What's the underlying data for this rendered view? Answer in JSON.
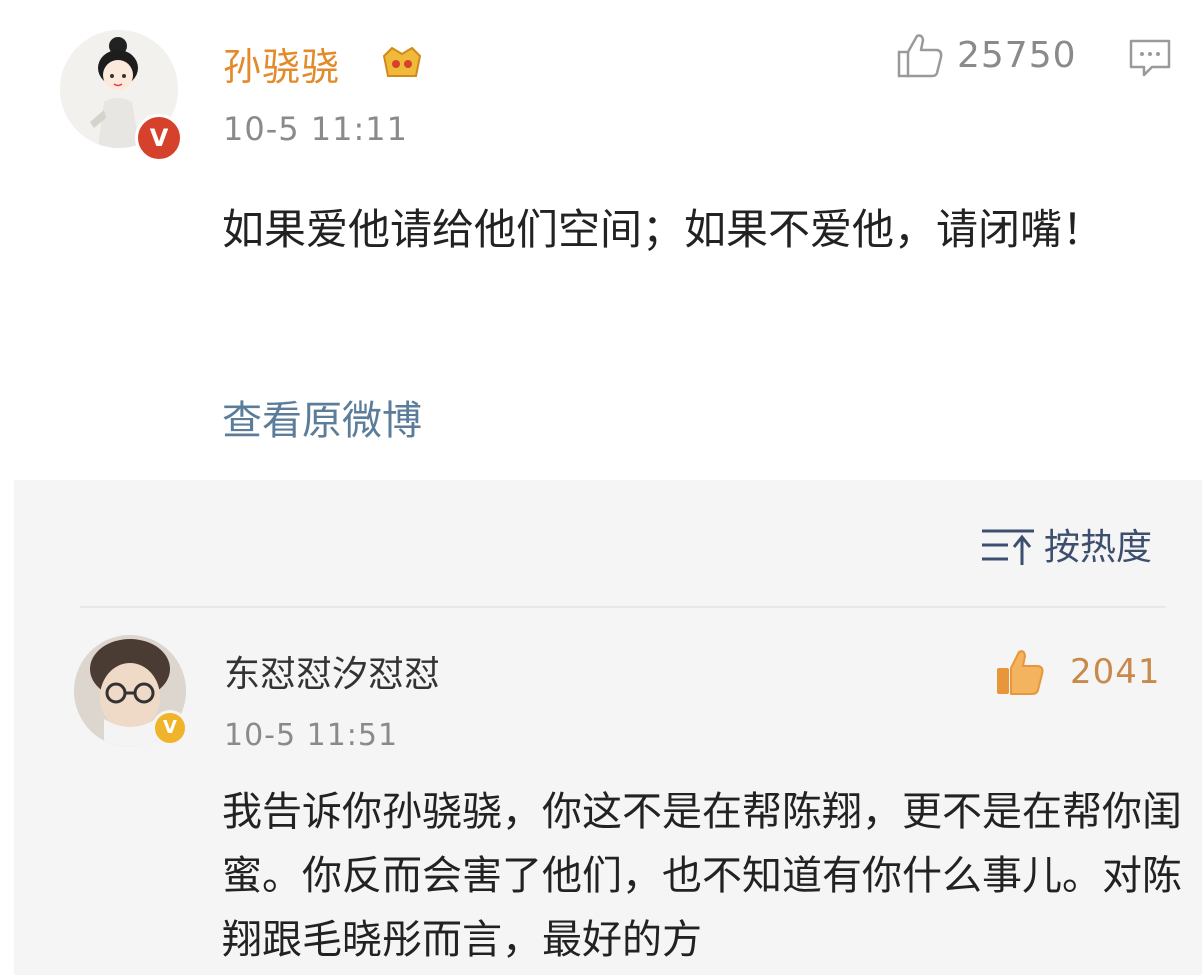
{
  "post": {
    "author": "孙骁骁",
    "time": "10-5 11:11",
    "likes": "25750",
    "text": "如果爱他请给他们空间；如果不爱他，请闭嘴！",
    "view_original": "查看原微博",
    "verified_badge": "V"
  },
  "sort": {
    "label": "按热度"
  },
  "comment": {
    "author": "东怼怼汐怼怼",
    "time": "10-5 11:51",
    "likes": "2041",
    "text": "我告诉你孙骁骁，你这不是在帮陈翔，更不是在帮你闺蜜。你反而会害了他们，也不知道有你什么事儿。对陈翔跟毛晓彤而言，最好的方",
    "verified_badge": "V"
  },
  "colors": {
    "author_orange": "#e38a2b",
    "link_blue": "#5b7d9a",
    "sort_blue": "#3d4f6e",
    "verified_red": "#d6412c",
    "verified_yellow": "#efb429",
    "like_orange": "#e8963a"
  },
  "icons": [
    "verified-icon",
    "vip-icon",
    "thumbs-up-icon",
    "comment-icon",
    "sort-icon"
  ]
}
